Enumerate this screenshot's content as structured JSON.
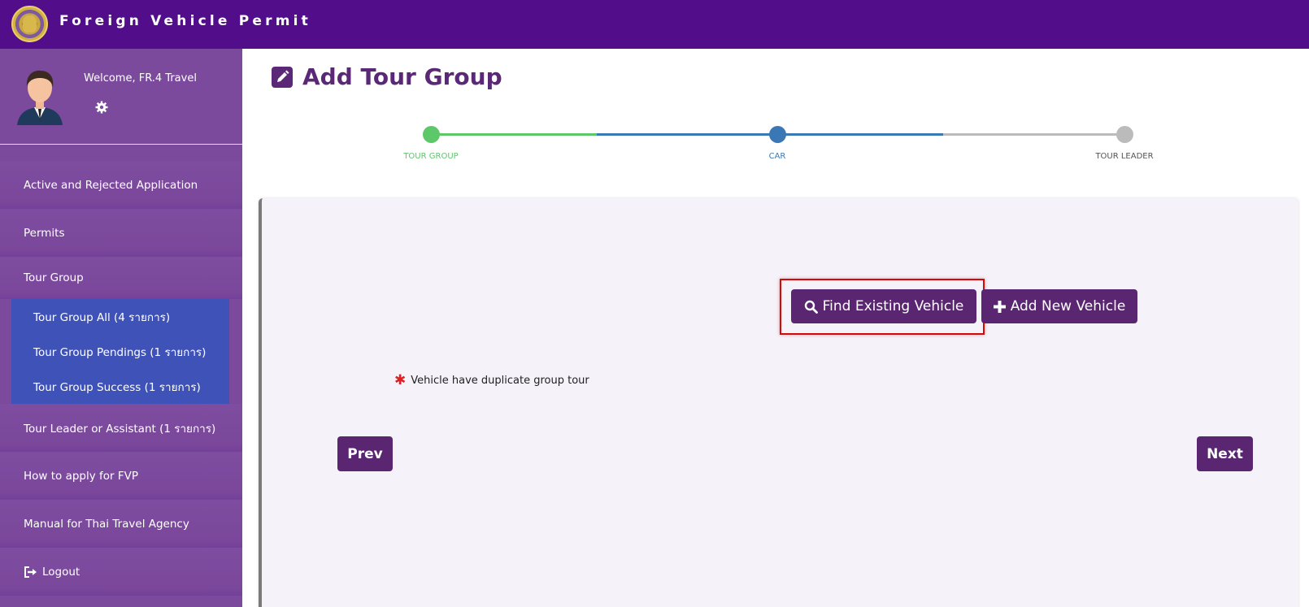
{
  "header": {
    "title": "Foreign Vehicle Permit"
  },
  "colors": {
    "brand": "#520e8a",
    "sidebar": "#7b4a9c",
    "submenu": "#3f52b8",
    "button": "#5a2671",
    "step_done": "#5cc86a",
    "step_active": "#3a78b5",
    "step_pending": "#bbbbbb",
    "highlight": "#d20a0a"
  },
  "sidebar": {
    "welcome": "Welcome, FR.4 Travel",
    "items": [
      {
        "label": "Active and Rejected Application"
      },
      {
        "label": "Permits"
      },
      {
        "label": "Tour Group"
      },
      {
        "label": "Tour Leader or Assistant (1 รายการ)"
      },
      {
        "label": "How to apply for FVP"
      },
      {
        "label": "Manual for Thai Travel Agency"
      },
      {
        "label": "Logout"
      }
    ],
    "tour_group_sub": [
      {
        "label": "Tour Group All (4 รายการ)"
      },
      {
        "label": "Tour Group Pendings (1 รายการ)"
      },
      {
        "label": "Tour Group Success (1 รายการ)"
      }
    ]
  },
  "main": {
    "title": "Add Tour Group",
    "steps": [
      {
        "label": "TOUR GROUP",
        "status": "done"
      },
      {
        "label": "CAR",
        "status": "active"
      },
      {
        "label": "TOUR LEADER",
        "status": "pending"
      }
    ],
    "find_vehicle_label": "Find Existing Vehicle",
    "add_vehicle_label": "Add New Vehicle",
    "note": "Vehicle have duplicate group tour",
    "prev_label": "Prev",
    "next_label": "Next"
  }
}
